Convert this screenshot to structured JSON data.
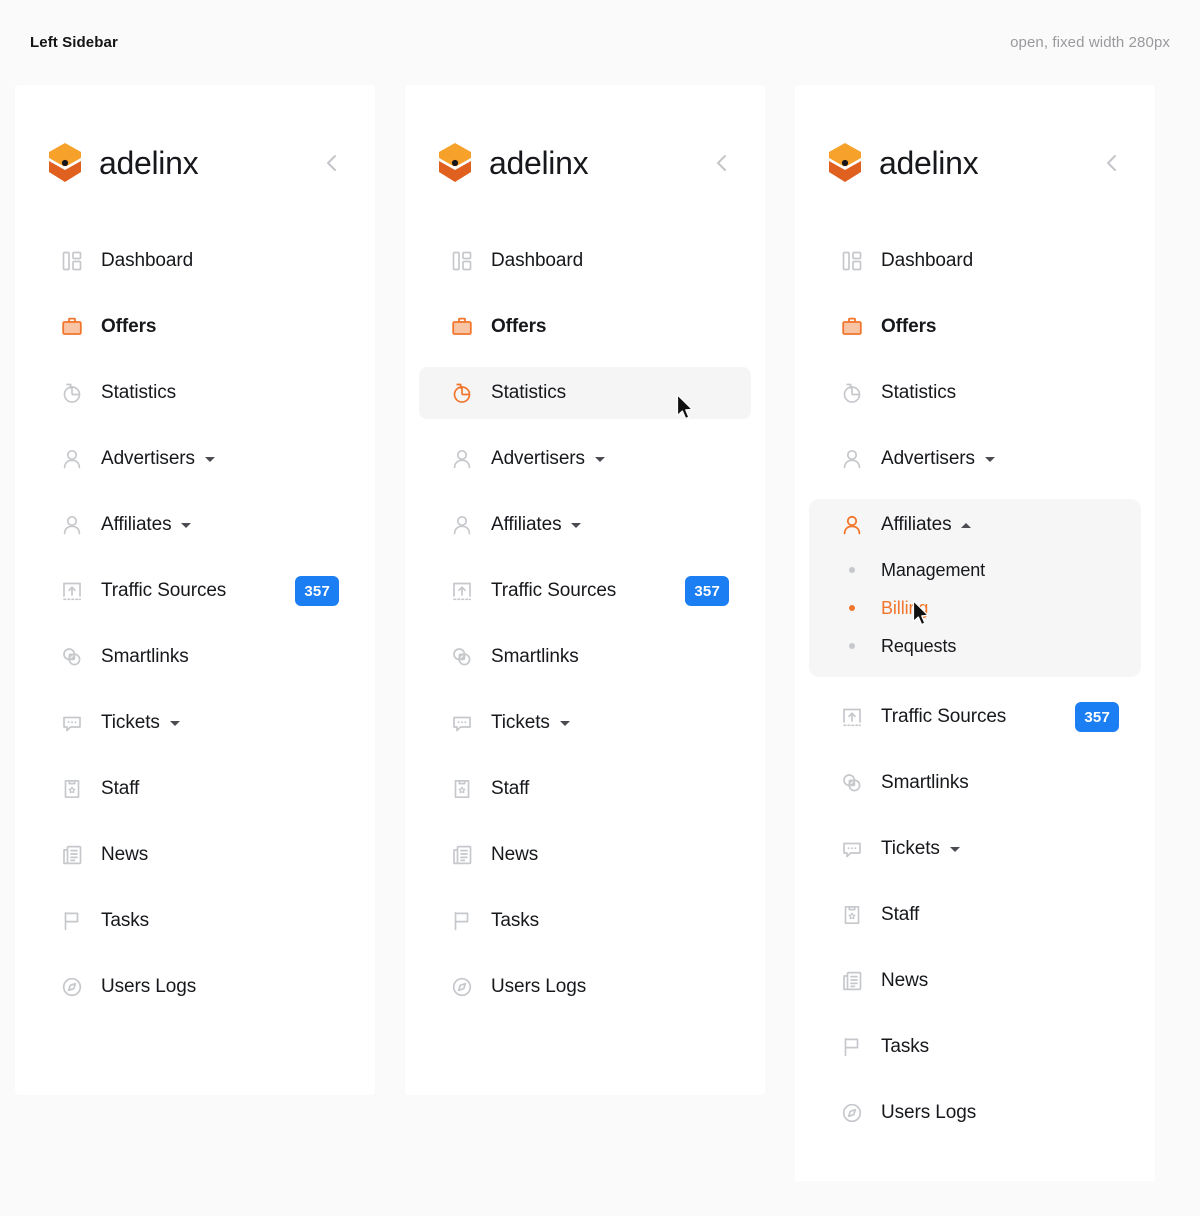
{
  "caption": {
    "title": "Left Sidebar",
    "note": "open, fixed width 280px"
  },
  "brand": {
    "name": "adelinx",
    "logo_icon": "adelinx-hexagon-logo",
    "collapse_icon": "chevron-left-icon"
  },
  "colors": {
    "accent": "#f1762c",
    "accent_soft": "#f9c4a4",
    "badge": "#1c7ef3",
    "icon_default": "#c6c8cc",
    "text": "#16181c",
    "panel_bg": "#ffffff",
    "page_bg": "#fafafa",
    "hover_bg": "#f5f5f6",
    "group_bg": "#f6f6f7"
  },
  "nav_items": [
    {
      "id": "dashboard",
      "label": "Dashboard",
      "icon": "dashboard-icon"
    },
    {
      "id": "offers",
      "label": "Offers",
      "icon": "briefcase-icon"
    },
    {
      "id": "statistics",
      "label": "Statistics",
      "icon": "pie-chart-icon"
    },
    {
      "id": "advertisers",
      "label": "Advertisers",
      "icon": "user-icon",
      "caret": "down"
    },
    {
      "id": "affiliates",
      "label": "Affiliates",
      "icon": "user-icon",
      "caret": "down"
    },
    {
      "id": "traffic-sources",
      "label": "Traffic Sources",
      "icon": "upload-box-icon",
      "badge": "357"
    },
    {
      "id": "smartlinks",
      "label": "Smartlinks",
      "icon": "link-rings-icon"
    },
    {
      "id": "tickets",
      "label": "Tickets",
      "icon": "chat-bubble-icon",
      "caret": "down"
    },
    {
      "id": "staff",
      "label": "Staff",
      "icon": "badge-star-icon"
    },
    {
      "id": "news",
      "label": "News",
      "icon": "newspaper-icon"
    },
    {
      "id": "tasks",
      "label": "Tasks",
      "icon": "flag-icon"
    },
    {
      "id": "users-logs",
      "label": "Users Logs",
      "icon": "compass-icon"
    }
  ],
  "affiliates_submenu": [
    {
      "id": "management",
      "label": "Management"
    },
    {
      "id": "billing",
      "label": "Billing"
    },
    {
      "id": "requests",
      "label": "Requests"
    }
  ],
  "panels": [
    {
      "id": "panel-default",
      "state": "default",
      "active_item": "offers"
    },
    {
      "id": "panel-hover",
      "state": "hover",
      "active_item": "offers",
      "hovered_item": "statistics"
    },
    {
      "id": "panel-expanded",
      "state": "expanded",
      "active_item": "offers",
      "expanded_item": "affiliates",
      "current_sub": "billing"
    }
  ]
}
